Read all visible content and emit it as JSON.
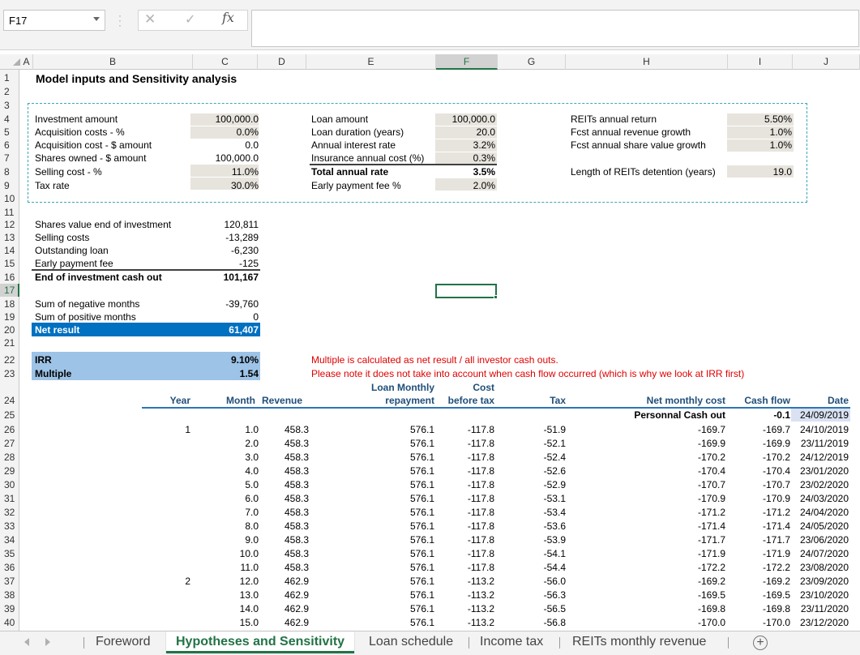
{
  "formula_bar": {
    "name_box": "F17",
    "fx_label": "fx",
    "cancel_glyph": "✕",
    "enter_glyph": "✓",
    "formula": ""
  },
  "columns": [
    "A",
    "B",
    "C",
    "D",
    "E",
    "F",
    "G",
    "H",
    "I",
    "J"
  ],
  "selected_column": "F",
  "selected_row": 17,
  "rows": [
    "1",
    "2",
    "3",
    "4",
    "5",
    "6",
    "7",
    "8",
    "9",
    "10",
    "11",
    "12",
    "13",
    "14",
    "15",
    "16",
    "17",
    "18",
    "19",
    "20",
    "21",
    "22",
    "23",
    "24",
    "25",
    "26",
    "27",
    "28",
    "29",
    "30",
    "31",
    "32",
    "33",
    "34",
    "35",
    "36",
    "37",
    "38",
    "39",
    "40"
  ],
  "title": "Model inputs and Sensitivity analysis",
  "inputs_left": [
    {
      "label": "Investment amount",
      "value": "100,000.0"
    },
    {
      "label": "Acquisition costs - %",
      "value": "0.0%"
    },
    {
      "label": "Acquisition cost - $ amount",
      "value": "0.0"
    },
    {
      "label": "Shares owned - $ amount",
      "value": "100,000.0"
    },
    {
      "label": "Selling cost - %",
      "value": "11.0%"
    },
    {
      "label": "Tax rate",
      "value": "30.0%"
    }
  ],
  "inputs_mid": [
    {
      "label": "Loan amount",
      "value": "100,000.0"
    },
    {
      "label": "Loan duration (years)",
      "value": "20.0"
    },
    {
      "label": "Annual interest rate",
      "value": "3.2%"
    },
    {
      "label": "Insurance annual cost (%)",
      "value": "0.3%"
    },
    {
      "label": "Total annual rate",
      "value": "3.5%"
    },
    {
      "label": "Early payment fee %",
      "value": "2.0%"
    }
  ],
  "inputs_right": [
    {
      "label": "REITs annual return",
      "value": "5.50%"
    },
    {
      "label": "Fcst annual revenue growth",
      "value": "1.0%"
    },
    {
      "label": "Fcst annual share value growth",
      "value": "1.0%"
    },
    {
      "label": "Length of REITs detention (years)",
      "value": "19.0"
    }
  ],
  "end_investment": [
    {
      "label": "Shares value end of investment",
      "value": "120,811"
    },
    {
      "label": "Selling costs",
      "value": "-13,289"
    },
    {
      "label": "Outstanding loan",
      "value": "-6,230"
    },
    {
      "label": "Early payment fee",
      "value": "-125"
    },
    {
      "label": "End of investment cash out",
      "value": "101,167"
    }
  ],
  "months_summary": [
    {
      "label": "Sum of negative months",
      "value": "-39,760"
    },
    {
      "label": "Sum of positive months",
      "value": "0"
    },
    {
      "label": "Net result",
      "value": "61,407"
    }
  ],
  "kpis": [
    {
      "label": "IRR",
      "value": "9.10%"
    },
    {
      "label": "Multiple",
      "value": "1.54"
    }
  ],
  "notes": [
    "Multiple is calculated as net result / all investor cash outs.",
    "Please note it does not take into account when cash flow occurred (which is why we look at IRR first)"
  ],
  "table": {
    "headers": {
      "year": "Year",
      "month": "Month",
      "revenue": "Revenue",
      "loan_line1": "Loan Monthly",
      "loan_line2": "repayment",
      "cost_line1": "Cost",
      "cost_line2": "before tax",
      "tax": "Tax",
      "net": "Net monthly cost",
      "cashflow": "Cash flow",
      "date": "Date"
    },
    "initial": {
      "label": "Personnal Cash out",
      "cashflow": "-0.1",
      "date": "24/09/2019"
    },
    "rows": [
      [
        "1",
        "1.0",
        "458.3",
        "576.1",
        "-117.8",
        "-51.9",
        "-169.7",
        "-169.7",
        "24/10/2019"
      ],
      [
        "",
        "2.0",
        "458.3",
        "576.1",
        "-117.8",
        "-52.1",
        "-169.9",
        "-169.9",
        "23/11/2019"
      ],
      [
        "",
        "3.0",
        "458.3",
        "576.1",
        "-117.8",
        "-52.4",
        "-170.2",
        "-170.2",
        "24/12/2019"
      ],
      [
        "",
        "4.0",
        "458.3",
        "576.1",
        "-117.8",
        "-52.6",
        "-170.4",
        "-170.4",
        "23/01/2020"
      ],
      [
        "",
        "5.0",
        "458.3",
        "576.1",
        "-117.8",
        "-52.9",
        "-170.7",
        "-170.7",
        "23/02/2020"
      ],
      [
        "",
        "6.0",
        "458.3",
        "576.1",
        "-117.8",
        "-53.1",
        "-170.9",
        "-170.9",
        "24/03/2020"
      ],
      [
        "",
        "7.0",
        "458.3",
        "576.1",
        "-117.8",
        "-53.4",
        "-171.2",
        "-171.2",
        "24/04/2020"
      ],
      [
        "",
        "8.0",
        "458.3",
        "576.1",
        "-117.8",
        "-53.6",
        "-171.4",
        "-171.4",
        "24/05/2020"
      ],
      [
        "",
        "9.0",
        "458.3",
        "576.1",
        "-117.8",
        "-53.9",
        "-171.7",
        "-171.7",
        "23/06/2020"
      ],
      [
        "",
        "10.0",
        "458.3",
        "576.1",
        "-117.8",
        "-54.1",
        "-171.9",
        "-171.9",
        "24/07/2020"
      ],
      [
        "",
        "11.0",
        "458.3",
        "576.1",
        "-117.8",
        "-54.4",
        "-172.2",
        "-172.2",
        "23/08/2020"
      ],
      [
        "2",
        "12.0",
        "462.9",
        "576.1",
        "-113.2",
        "-56.0",
        "-169.2",
        "-169.2",
        "23/09/2020"
      ],
      [
        "",
        "13.0",
        "462.9",
        "576.1",
        "-113.2",
        "-56.3",
        "-169.5",
        "-169.5",
        "23/10/2020"
      ],
      [
        "",
        "14.0",
        "462.9",
        "576.1",
        "-113.2",
        "-56.5",
        "-169.8",
        "-169.8",
        "23/11/2020"
      ],
      [
        "",
        "15.0",
        "462.9",
        "576.1",
        "-113.2",
        "-56.8",
        "-170.0",
        "-170.0",
        "23/12/2020"
      ]
    ]
  },
  "sheet_tabs": [
    "Foreword",
    "Hypotheses and Sensitivity",
    "Loan schedule",
    "Income tax",
    "REITs monthly revenue"
  ],
  "active_tab": "Hypotheses and Sensitivity",
  "add_sheet_glyph": "+",
  "colors": {
    "accent": "#217346",
    "net_result_fill": "#0070c0",
    "kpi_fill": "#9dc3e6",
    "input_fill": "#e7e4dd",
    "note_text": "#e00000"
  }
}
